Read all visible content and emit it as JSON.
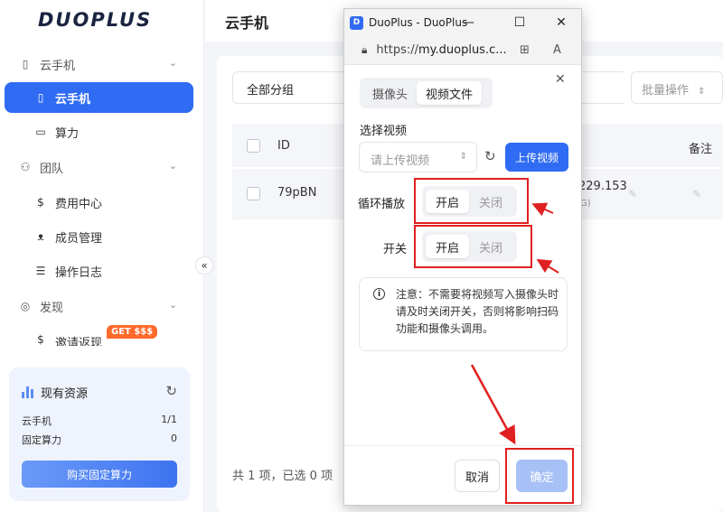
{
  "sidebar": {
    "logo": "DUOPLUS",
    "items": [
      {
        "label": "云手机",
        "icon": "phone-outline-icon"
      },
      {
        "label": "云手机",
        "icon": "phone-icon"
      },
      {
        "label": "算力",
        "icon": "monitor-icon"
      },
      {
        "label": "团队",
        "icon": "users-icon"
      },
      {
        "label": "费用中心",
        "icon": "dollar-circle-icon"
      },
      {
        "label": "成员管理",
        "icon": "user-manage-icon"
      },
      {
        "label": "操作日志",
        "icon": "log-icon"
      },
      {
        "label": "发现",
        "icon": "compass-icon"
      },
      {
        "label": "邀请返现",
        "icon": "dollar-icon"
      }
    ],
    "badge": "GET $$$",
    "resources": {
      "title": "现有资源",
      "rows": [
        {
          "label": "云手机",
          "value": "1/1"
        },
        {
          "label": "固定算力",
          "value": "0"
        }
      ],
      "buy_label": "购买固定算力"
    },
    "collapse_glyph": "«"
  },
  "main": {
    "title": "云手机",
    "group_select": "全部分组",
    "batch_select": "批量操作",
    "table": {
      "headers": {
        "id": "ID",
        "remark": "备注"
      },
      "row": {
        "id": "79pBN",
        "ip": "229.153",
        "ip_sub": "G)"
      }
    },
    "footer": "共 1 项，已选 0 项"
  },
  "popup": {
    "window_title": "DuoPlus - DuoPlus...",
    "url_prefix": "https://",
    "url_host": "my.duoplus.c...",
    "tabs": [
      "摄像头",
      "视频文件"
    ],
    "select_video_label": "选择视频",
    "video_placeholder": "请上传视频",
    "upload_label": "上传视频",
    "loop_label": "循环播放",
    "switch_label": "开关",
    "on_label": "开启",
    "off_label": "关闭",
    "notice": "注意：不需要将视频写入摄像头时请及时关闭开关，否则将影响扫码功能和摄像头调用。",
    "cancel_label": "取消",
    "ok_label": "确定"
  },
  "colors": {
    "accent": "#2f6bf3",
    "annotation": "#e02020"
  }
}
